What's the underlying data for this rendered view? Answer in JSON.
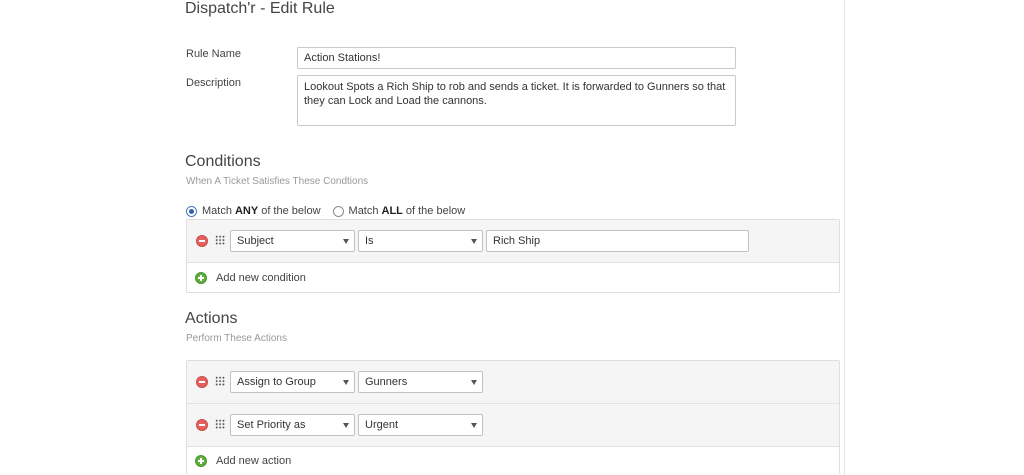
{
  "page": {
    "title": "Dispatch'r - Edit Rule"
  },
  "form": {
    "rule_name_label": "Rule Name",
    "rule_name_value": "Action Stations!",
    "description_label": "Description",
    "description_value": "Lookout Spots a Rich Ship to rob and sends a ticket. It is forwarded to Gunners so that they can Lock and Load the cannons."
  },
  "conditions": {
    "title": "Conditions",
    "subtitle": "When A Ticket Satisfies These Condtions",
    "match_any": {
      "prefix": "Match",
      "bold": "ANY",
      "suffix": "of the below",
      "selected": true
    },
    "match_all": {
      "prefix": "Match",
      "bold": "ALL",
      "suffix": "of the below",
      "selected": false
    },
    "rows": [
      {
        "field": "Subject",
        "operator": "Is",
        "value": "Rich Ship"
      }
    ],
    "add_label": "Add new condition"
  },
  "actions": {
    "title": "Actions",
    "subtitle": "Perform These Actions",
    "rows": [
      {
        "action": "Assign to Group",
        "value": "Gunners"
      },
      {
        "action": "Set Priority as",
        "value": "Urgent"
      }
    ],
    "add_label": "Add new action"
  },
  "colors": {
    "remove": "#e3625f",
    "add": "#5fae3f",
    "radio_selected": "#2f62a8"
  },
  "icons": {
    "remove": "minus-circle-icon",
    "drag": "drag-handle-icon",
    "add": "plus-circle-icon",
    "caret": "chevron-down-icon"
  }
}
